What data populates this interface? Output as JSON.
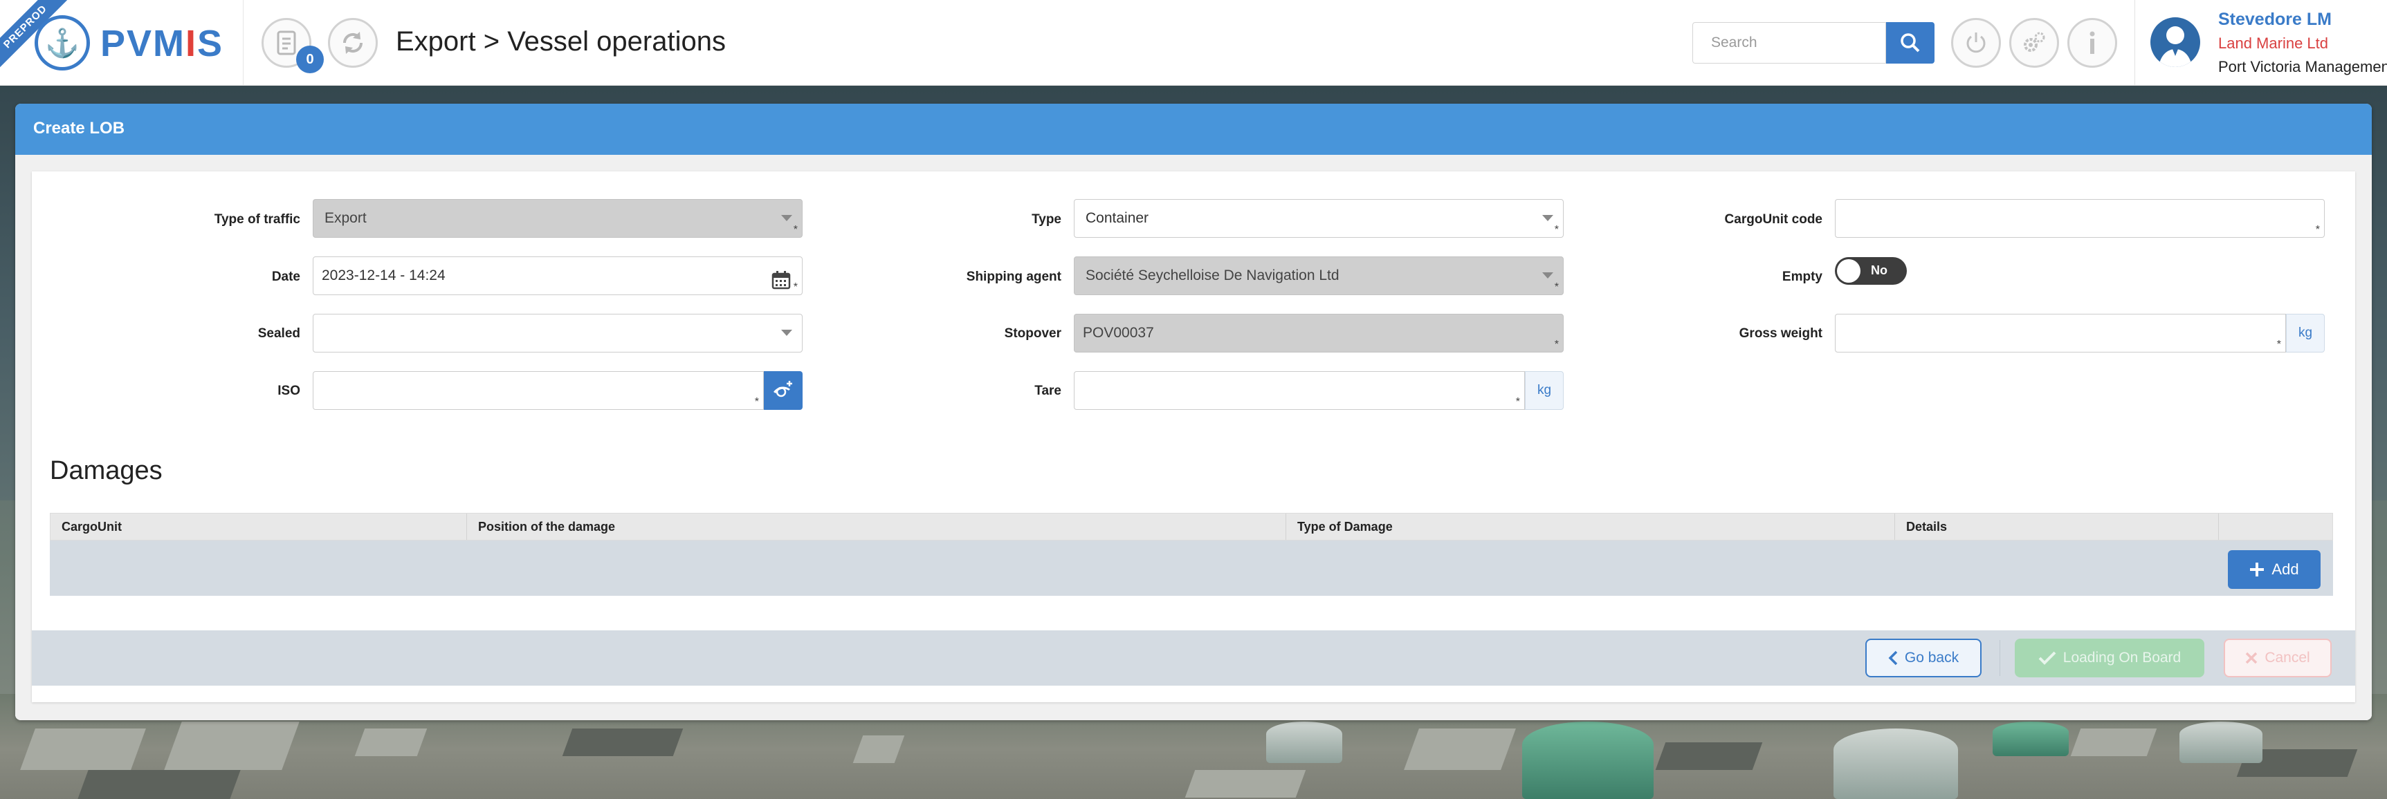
{
  "env_ribbon": "PREPROD",
  "brand": {
    "name_part1": "PVM",
    "name_part2": "I",
    "name_part3": "S"
  },
  "header": {
    "notification_count": "0",
    "breadcrumb": "Export > Vessel operations",
    "search_placeholder": "Search"
  },
  "user": {
    "name": "Stevedore LM",
    "company": "Land Marine Ltd",
    "port": "Port Victoria Management"
  },
  "panel": {
    "title": "Create LOB"
  },
  "form": {
    "type_of_traffic": {
      "label": "Type of traffic",
      "value": "Export"
    },
    "date": {
      "label": "Date",
      "value": "2023-12-14 - 14:24"
    },
    "sealed": {
      "label": "Sealed",
      "value": ""
    },
    "iso": {
      "label": "ISO",
      "value": ""
    },
    "type": {
      "label": "Type",
      "value": "Container"
    },
    "shipping_agent": {
      "label": "Shipping agent",
      "value": "Société Seychelloise De Navigation Ltd"
    },
    "stopover": {
      "label": "Stopover",
      "value": "POV00037"
    },
    "tare": {
      "label": "Tare",
      "value": "",
      "unit": "kg"
    },
    "cargounit_code": {
      "label": "CargoUnit code",
      "value": ""
    },
    "empty": {
      "label": "Empty",
      "toggle_text": "No"
    },
    "gross_weight": {
      "label": "Gross weight",
      "value": "",
      "unit": "kg"
    },
    "required_mark": "*"
  },
  "damages": {
    "title": "Damages",
    "columns": [
      "CargoUnit",
      "Position of the damage",
      "Type of Damage",
      "Details"
    ],
    "add_label": "Add"
  },
  "actions": {
    "go_back": "Go back",
    "loading_on_board": "Loading On Board",
    "cancel": "Cancel"
  },
  "colors": {
    "accent": "#3a7bc8",
    "header_bar": "#4895da",
    "danger": "#d94040",
    "success_disabled": "#a6d8b2"
  }
}
